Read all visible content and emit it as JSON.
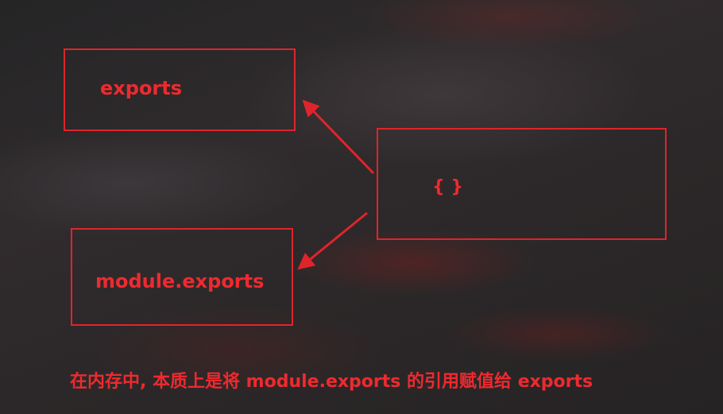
{
  "diagram": {
    "nodes": {
      "exports": "exports",
      "object": "{ }",
      "module_exports": "module.exports"
    },
    "edges": [
      {
        "from": "object",
        "to": "exports"
      },
      {
        "from": "object",
        "to": "module_exports"
      }
    ],
    "caption": "在内存中, 本质上是将 module.exports 的引用赋值给 exports"
  },
  "colors": {
    "accent": "#e0242b",
    "background": "#2a2628"
  }
}
